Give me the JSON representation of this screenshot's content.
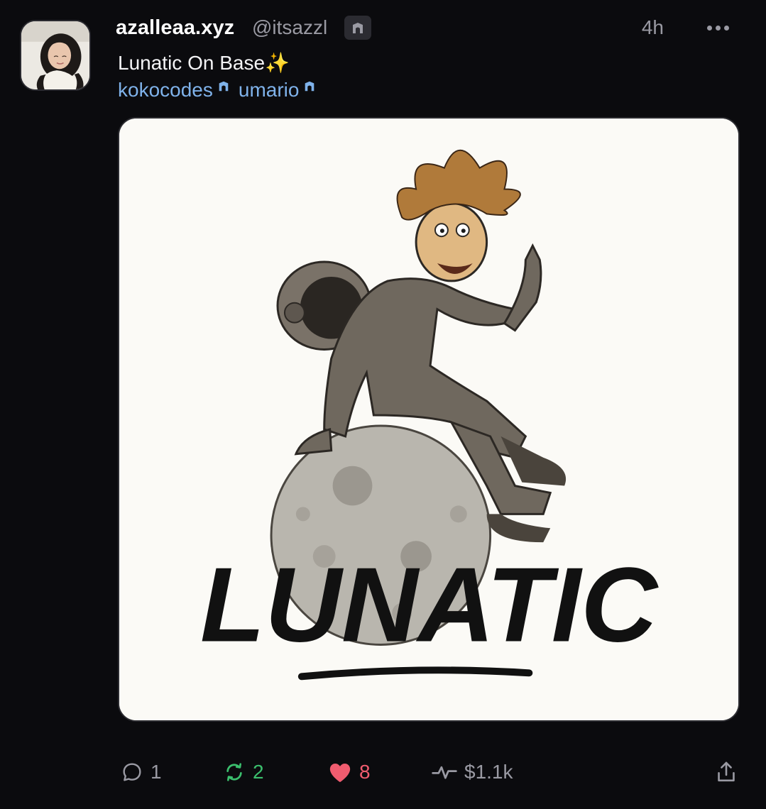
{
  "post": {
    "author": {
      "display_name": "azalleaa.xyz",
      "handle": "@itsazzl",
      "badge_icon": "arch-badge-icon"
    },
    "timestamp": "4h",
    "text": "Lunatic On Base✨",
    "mentions": [
      {
        "name": "kokocodes",
        "badge_icon": "arch-badge-icon"
      },
      {
        "name": "umario",
        "badge_icon": "arch-badge-icon"
      }
    ],
    "media": {
      "logo_text": "LUNATIC"
    },
    "actions": {
      "reply_count": "1",
      "recast_count": "2",
      "like_count": "8",
      "tip_amount": "$1.1k"
    }
  },
  "colors": {
    "background": "#0b0b0e",
    "muted_text": "#9a9aa3",
    "mention": "#7fb2ea",
    "recast": "#3bbf6d",
    "like": "#f05c6f"
  }
}
